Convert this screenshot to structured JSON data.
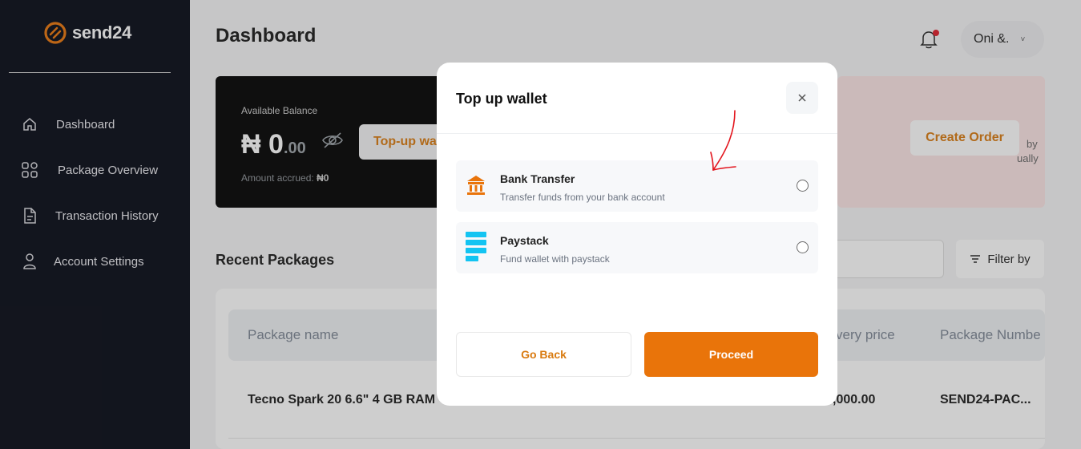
{
  "app": {
    "logo_text": "send24",
    "brand_color": "#e9740a"
  },
  "sidebar": {
    "items": [
      {
        "label": "Dashboard",
        "icon": "home-icon"
      },
      {
        "label": "Package Overview",
        "icon": "grid-icon"
      },
      {
        "label": "Transaction History",
        "icon": "document-icon"
      },
      {
        "label": "Account Settings",
        "icon": "user-icon"
      }
    ]
  },
  "header": {
    "title": "Dashboard",
    "user_name": "Oni &.",
    "chevron": "˅"
  },
  "balance": {
    "label": "Available Balance",
    "currency": "₦",
    "amount": "0",
    "cents": ".00",
    "accrued_label": "Amount accrued:",
    "accrued_value": "₦0",
    "topup_label": "Top-up wa"
  },
  "promo": {
    "line1": "by",
    "line2": "ually",
    "create_order": "Create Order"
  },
  "packages": {
    "title": "Recent Packages",
    "filter_label": "Filter by",
    "columns": [
      "Package name",
      "very price",
      "Package Numbe"
    ],
    "rows": [
      {
        "name": "Tecno Spark 20 6.6\" 4 GB RAM",
        "price": ",000.00",
        "number": "SEND24-PAC..."
      }
    ]
  },
  "modal": {
    "title": "Top up wallet",
    "options": [
      {
        "title": "Bank Transfer",
        "desc": "Transfer funds from your bank account",
        "icon": "bank-icon"
      },
      {
        "title": "Paystack",
        "desc": "Fund wallet with paystack",
        "icon": "paystack-icon"
      }
    ],
    "go_back": "Go Back",
    "proceed": "Proceed"
  }
}
